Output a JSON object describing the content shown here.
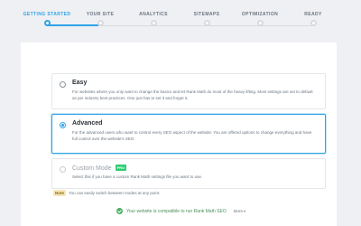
{
  "steps": [
    {
      "label": "GETTING STARTED",
      "active": true
    },
    {
      "label": "YOUR SITE",
      "active": false
    },
    {
      "label": "ANALYTICS",
      "active": false
    },
    {
      "label": "SITEMAPS",
      "active": false
    },
    {
      "label": "OPTIMIZATION",
      "active": false
    },
    {
      "label": "READY",
      "active": false
    }
  ],
  "options": {
    "easy": {
      "title": "Easy",
      "description": "For websites where you only want to change the basics and let Rank Math do most of the heavy lifting. Most settings are set to default as per industry best practices. One just has to set it and forget it.",
      "selected": false
    },
    "advanced": {
      "title": "Advanced",
      "description": "For the advanced users who want to control every SEO aspect of the website. You are offered options to change everything and have full control over the website's SEO.",
      "selected": true
    },
    "custom": {
      "title": "Custom Mode",
      "badge": "PRO",
      "description": "Select this if you have a custom Rank Math settings file you want to use.",
      "selected": false,
      "disabled": true
    }
  },
  "note": {
    "tag": "Note",
    "text": "You can easily switch between modes at any point."
  },
  "compat": {
    "text": "Your website is compatible to run Rank Math SEO",
    "more_label": "More",
    "more_icon": "chevron-down-icon"
  },
  "colors": {
    "accent": "#2fa3e6",
    "success": "#45b05e",
    "pro_badge": "#2ecc71",
    "note_bg": "#f8e7b9"
  }
}
